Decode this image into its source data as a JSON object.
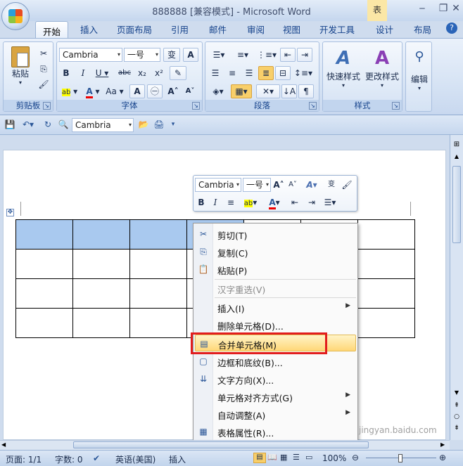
{
  "window": {
    "title": "888888 [兼容模式] - Microsoft Word",
    "context_tab": "表"
  },
  "tabs": [
    "开始",
    "插入",
    "页面布局",
    "引用",
    "邮件",
    "审阅",
    "视图",
    "开发工具",
    "设计",
    "布局"
  ],
  "ribbon": {
    "clipboard": {
      "label": "剪贴板",
      "paste": "粘贴"
    },
    "font": {
      "label": "字体",
      "font_name": "Cambria",
      "font_size": "一号"
    },
    "paragraph": {
      "label": "段落"
    },
    "styles": {
      "label": "样式",
      "quick_styles": "快速样式",
      "change_styles": "更改样式"
    },
    "editing": {
      "label": "编辑"
    }
  },
  "qat": {
    "font_name": "Cambria"
  },
  "mini_toolbar": {
    "font_name": "Cambria",
    "font_size": "一号"
  },
  "context_menu": {
    "items": [
      {
        "label": "剪切(T)",
        "icon": "scissors-icon"
      },
      {
        "label": "复制(C)",
        "icon": "copy-icon"
      },
      {
        "label": "粘贴(P)",
        "icon": "paste-icon"
      },
      {
        "label": "汉字重选(V)",
        "disabled": true
      },
      {
        "label": "插入(I)",
        "submenu": true
      },
      {
        "label": "删除单元格(D)..."
      },
      {
        "label": "合并单元格(M)",
        "icon": "merge-cells-icon",
        "highlighted": true
      },
      {
        "label": "边框和底纹(B)...",
        "icon": "borders-icon"
      },
      {
        "label": "文字方向(X)...",
        "icon": "text-direction-icon"
      },
      {
        "label": "单元格对齐方式(G)",
        "submenu": true
      },
      {
        "label": "自动调整(A)",
        "submenu": true
      },
      {
        "label": "表格属性(R)...",
        "icon": "table-properties-icon"
      }
    ]
  },
  "status_bar": {
    "page": "页面: 1/1",
    "words": "字数: 0",
    "language": "英语(美国)",
    "mode": "插入",
    "zoom": "100%"
  },
  "watermark": "jingyan.baidu.com"
}
